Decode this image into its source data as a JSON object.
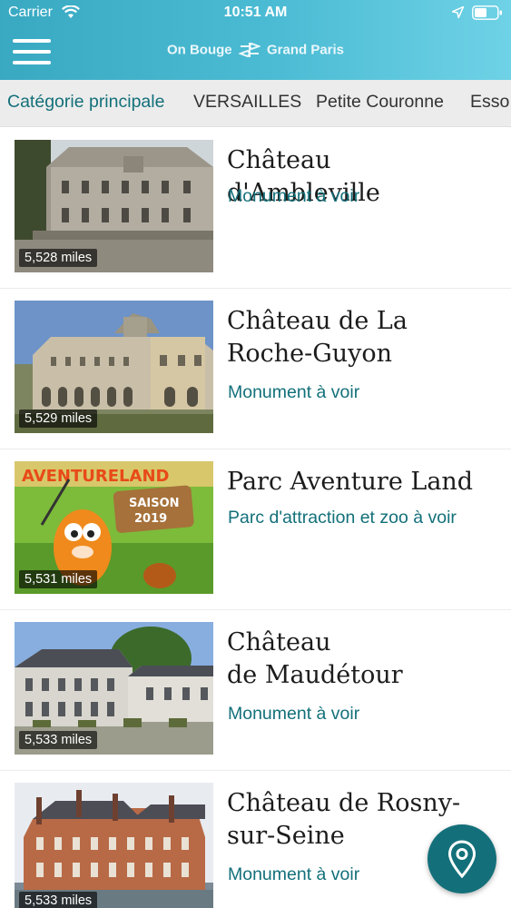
{
  "status_bar": {
    "carrier": "Carrier",
    "time": "10:51 AM"
  },
  "header": {
    "logo_left": "On Bouge",
    "logo_right": "Grand Paris",
    "icons": [
      "menu-icon",
      "logo-icon"
    ]
  },
  "tabs": [
    {
      "label": "Catégorie principale",
      "active": true
    },
    {
      "label": "VERSAILLES",
      "active": false
    },
    {
      "label": "Petite Couronne",
      "active": false
    },
    {
      "label": "Esso",
      "active": false
    }
  ],
  "items": [
    {
      "title_line1": "Château d'Ambleville",
      "title_line2": "",
      "category": "Monument à voir",
      "distance": "5,528 miles"
    },
    {
      "title_line1": "Château de La",
      "title_line2": "Roche-Guyon",
      "category": "Monument à voir",
      "distance": "5,529 miles"
    },
    {
      "title_line1": "Parc Aventure Land",
      "title_line2": "",
      "category": "Parc d'attraction et zoo  à voir",
      "distance": "5,531 miles"
    },
    {
      "title_line1": "Château",
      "title_line2": "de Maudétour",
      "category": "Monument à voir",
      "distance": "5,533 miles"
    },
    {
      "title_line1": "Château de Rosny-",
      "title_line2": "sur-Seine",
      "category": "Monument à voir",
      "distance": "5,533 miles"
    }
  ],
  "thumbnail_text": {
    "aventure_sign": "AVENTURELAND",
    "saison_line1": "SAISON",
    "saison_line2": "2019"
  },
  "colors": {
    "header_start": "#39a9c2",
    "header_end": "#6fd2e6",
    "accent": "#13707a",
    "tab_bar": "#ececec"
  },
  "fab": {
    "icon": "map-pin-icon"
  }
}
